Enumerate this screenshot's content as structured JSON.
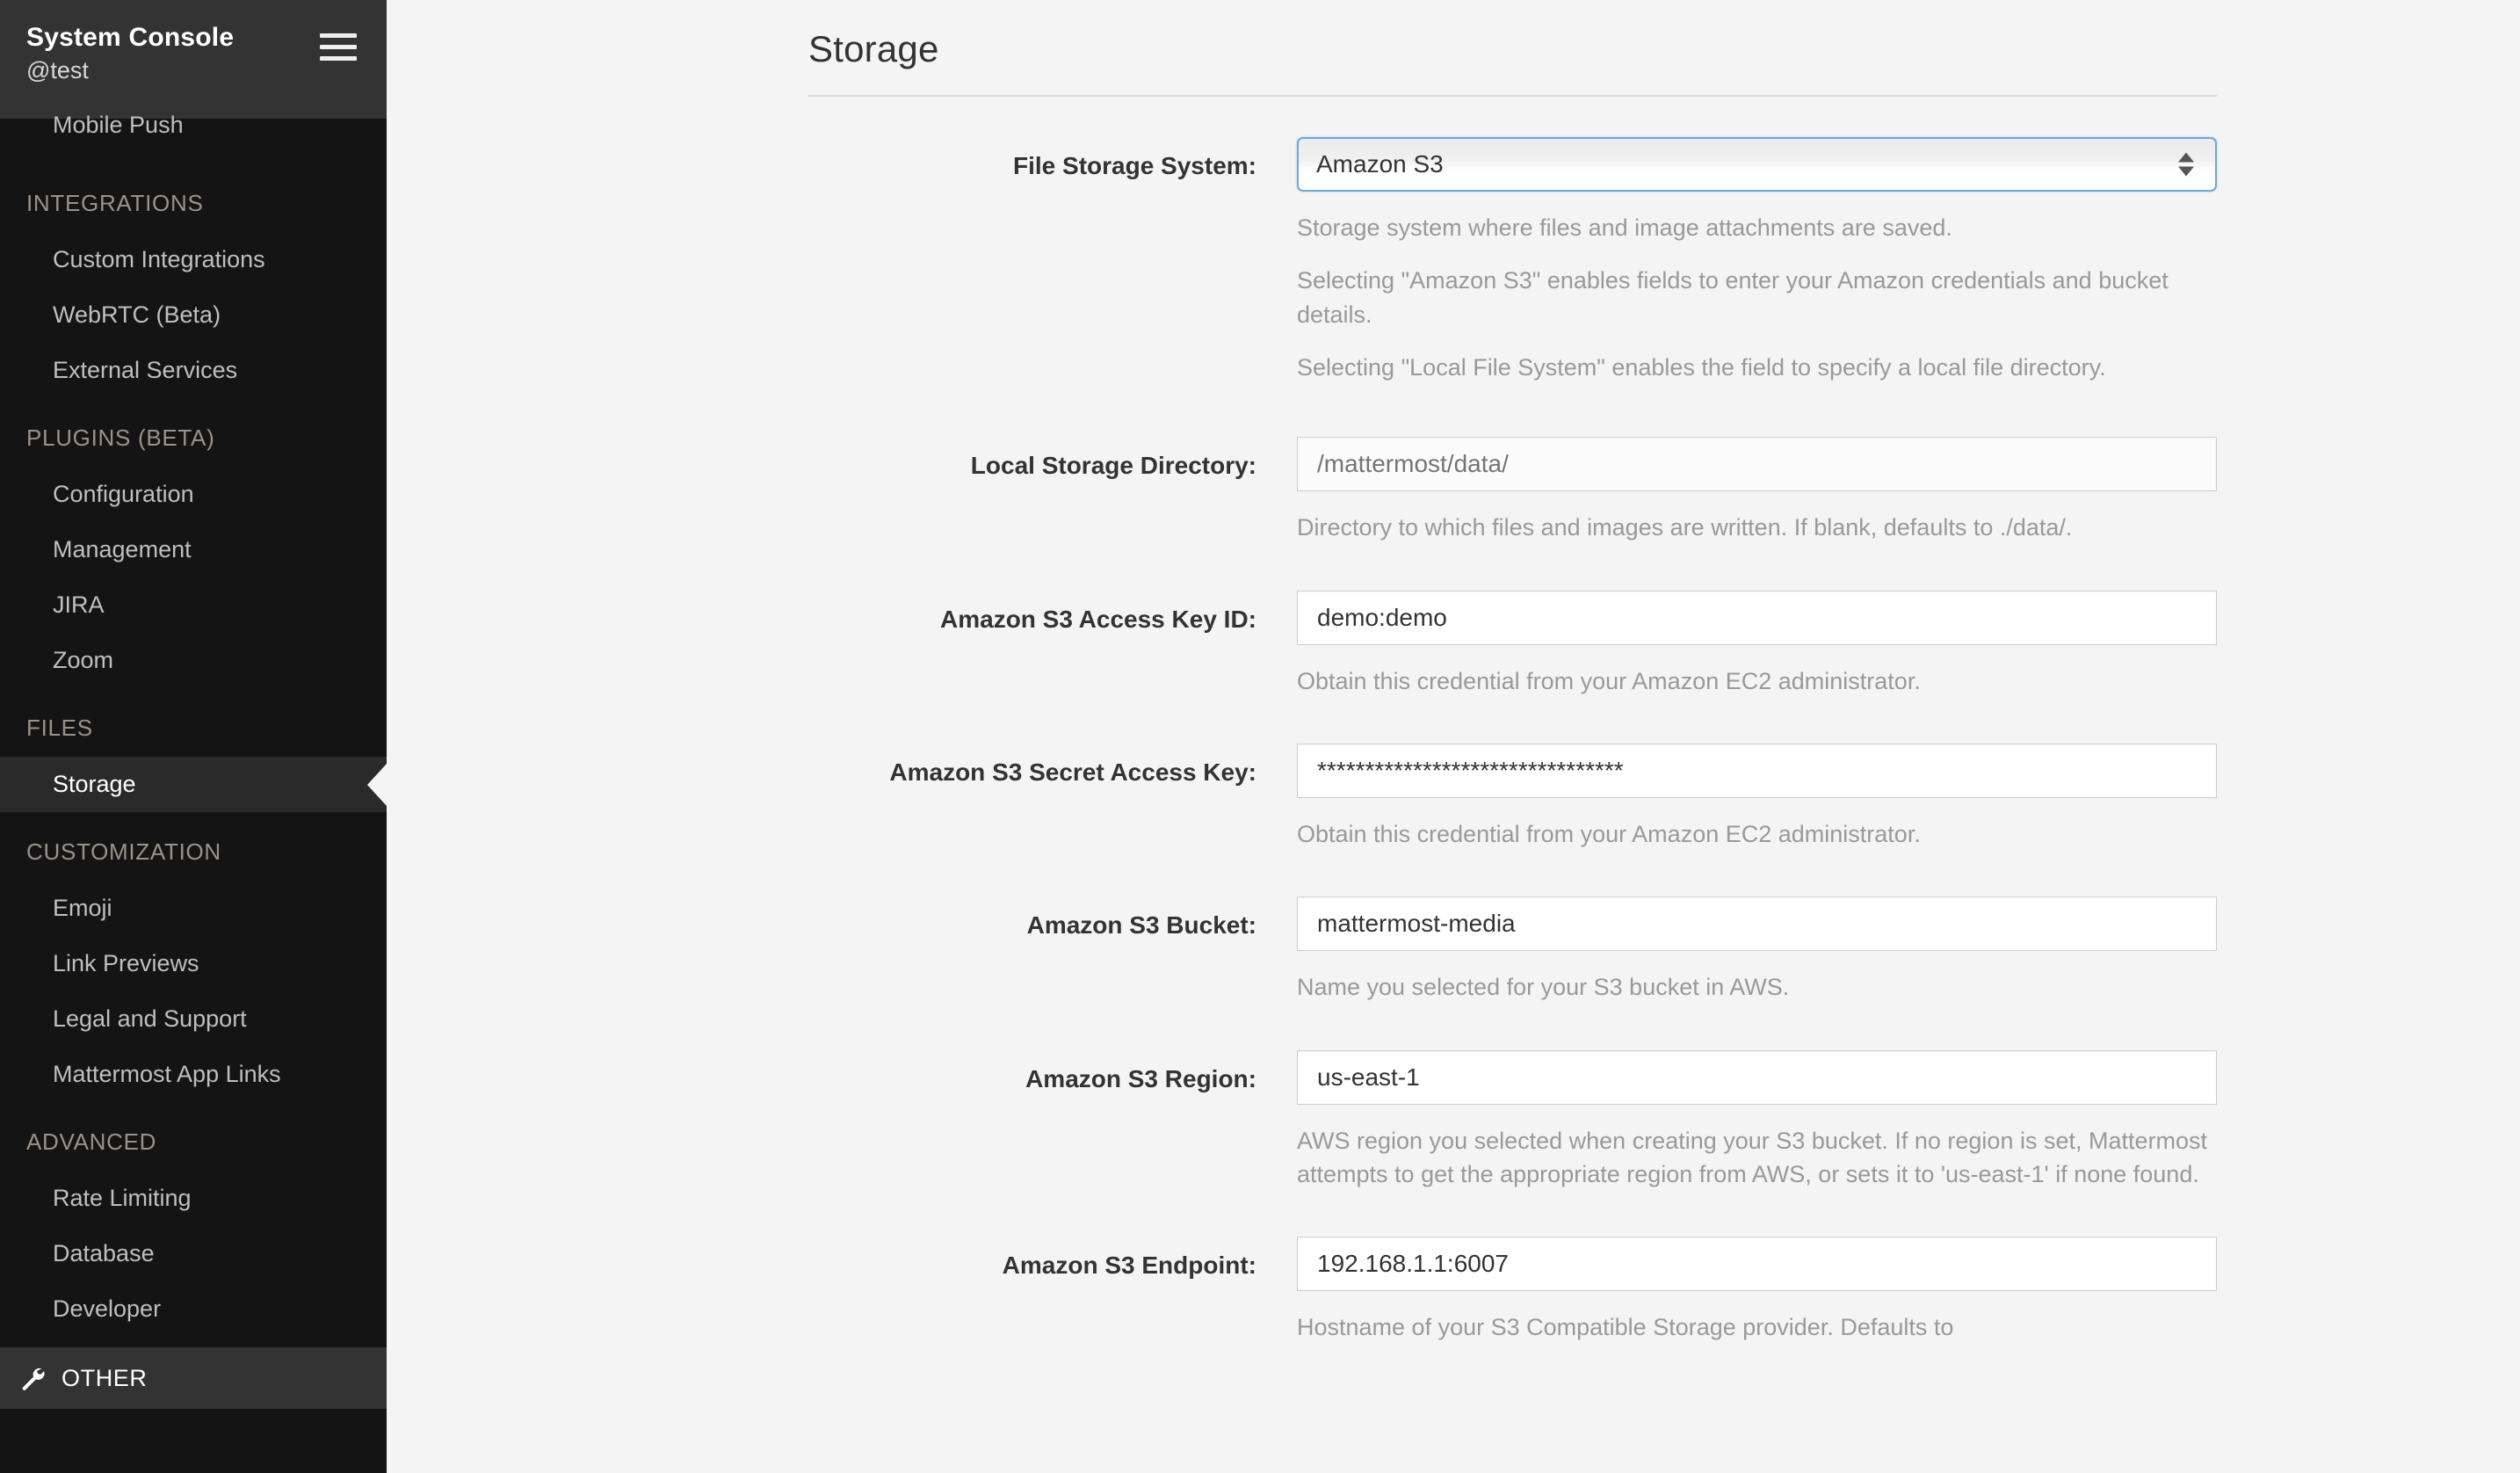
{
  "sidebar": {
    "title": "System Console",
    "user": "@test",
    "menu_icon": "hamburger-icon",
    "truncated_top_item": "Mobile Push",
    "sections": [
      {
        "label": "INTEGRATIONS",
        "items": [
          "Custom Integrations",
          "WebRTC (Beta)",
          "External Services"
        ]
      },
      {
        "label": "PLUGINS (BETA)",
        "items": [
          "Configuration",
          "Management",
          "JIRA",
          "Zoom"
        ]
      },
      {
        "label": "FILES",
        "items": [
          "Storage"
        ]
      },
      {
        "label": "CUSTOMIZATION",
        "items": [
          "Emoji",
          "Link Previews",
          "Legal and Support",
          "Mattermost App Links"
        ]
      },
      {
        "label": "ADVANCED",
        "items": [
          "Rate Limiting",
          "Database",
          "Developer"
        ]
      }
    ],
    "active_item": "Storage",
    "other": {
      "label": "OTHER",
      "icon": "wrench-icon"
    }
  },
  "main": {
    "page_title": "Storage",
    "fields": [
      {
        "label": "File Storage System:",
        "type": "select",
        "value": "Amazon S3",
        "options": [
          "Amazon S3",
          "Local File System"
        ],
        "help": [
          "Storage system where files and image attachments are saved.",
          "Selecting \"Amazon S3\" enables fields to enter your Amazon credentials and bucket details.",
          "Selecting \"Local File System\" enables the field to specify a local file directory."
        ]
      },
      {
        "label": "Local Storage Directory:",
        "type": "text",
        "value": "",
        "placeholder": "/mattermost/data/",
        "help": [
          "Directory to which files and images are written. If blank, defaults to ./data/."
        ]
      },
      {
        "label": "Amazon S3 Access Key ID:",
        "type": "text",
        "value": "demo:demo",
        "placeholder": "",
        "help": [
          "Obtain this credential from your Amazon EC2 administrator."
        ]
      },
      {
        "label": "Amazon S3 Secret Access Key:",
        "type": "text",
        "value": "********************************",
        "placeholder": "",
        "help": [
          "Obtain this credential from your Amazon EC2 administrator."
        ]
      },
      {
        "label": "Amazon S3 Bucket:",
        "type": "text",
        "value": "mattermost-media",
        "placeholder": "",
        "help": [
          "Name you selected for your S3 bucket in AWS."
        ]
      },
      {
        "label": "Amazon S3 Region:",
        "type": "text",
        "value": "us-east-1",
        "placeholder": "",
        "help": [
          "AWS region you selected when creating your S3 bucket. If no region is set, Mattermost attempts to get the appropriate region from AWS, or sets it to 'us-east-1' if none found."
        ]
      },
      {
        "label": "Amazon S3 Endpoint:",
        "type": "text",
        "value": "192.168.1.1:6007",
        "placeholder": "",
        "help": [
          "Hostname of your S3 Compatible Storage provider. Defaults to"
        ]
      }
    ]
  }
}
